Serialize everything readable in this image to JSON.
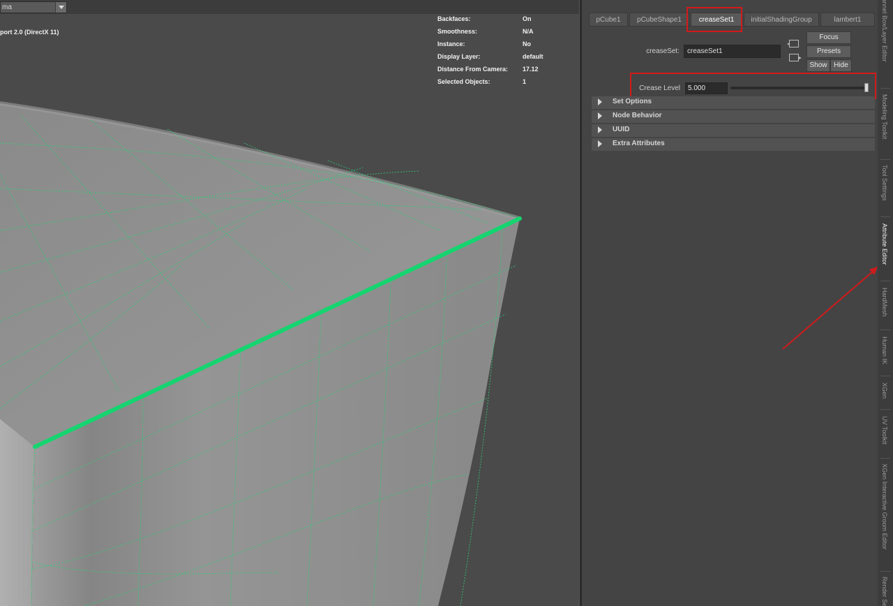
{
  "viewport": {
    "camera_menu_value": "ma",
    "renderer_label": "port 2.0 (DirectX 11)",
    "hud": [
      {
        "label": "Backfaces:",
        "value": "On"
      },
      {
        "label": "Smoothness:",
        "value": "N/A"
      },
      {
        "label": "Instance:",
        "value": "No"
      },
      {
        "label": "Display Layer:",
        "value": "default"
      },
      {
        "label": "Distance From Camera:",
        "value": "17.12"
      },
      {
        "label": "Selected Objects:",
        "value": "1"
      }
    ]
  },
  "attribute_editor": {
    "tabs": [
      "pCube1",
      "pCubeShape1",
      "creaseSet1",
      "initialShadingGroup",
      "lambert1"
    ],
    "active_tab": "creaseSet1",
    "creaseset_label": "creaseSet:",
    "creaseset_value": "creaseSet1",
    "buttons": {
      "focus": "Focus",
      "presets": "Presets",
      "show": "Show",
      "hide": "Hide"
    },
    "crease_level_label": "Crease Level",
    "crease_level_value": "5.000",
    "crease_level_slider_fraction": 1.0,
    "sections": [
      "Set Options",
      "Node Behavior",
      "UUID",
      "Extra Attributes"
    ]
  },
  "side_tabs": [
    {
      "label": "Channel Box/Layer Editor",
      "active": false
    },
    {
      "label": "Modeling Toolkit",
      "active": false
    },
    {
      "label": "Tool Settings",
      "active": false
    },
    {
      "label": "Attribute Editor",
      "active": true
    },
    {
      "label": "HardMesh",
      "active": false
    },
    {
      "label": "Human IK",
      "active": false
    },
    {
      "label": "XGen",
      "active": false
    },
    {
      "label": "UV Toolkit",
      "active": false
    },
    {
      "label": "XGen Interactive Groom Editor",
      "active": false
    },
    {
      "label": "Render Setup",
      "active": false
    }
  ],
  "colors": {
    "highlight_red": "#d21a1a",
    "edge_green": "#16d470",
    "wire_green": "#2fcf7a"
  }
}
